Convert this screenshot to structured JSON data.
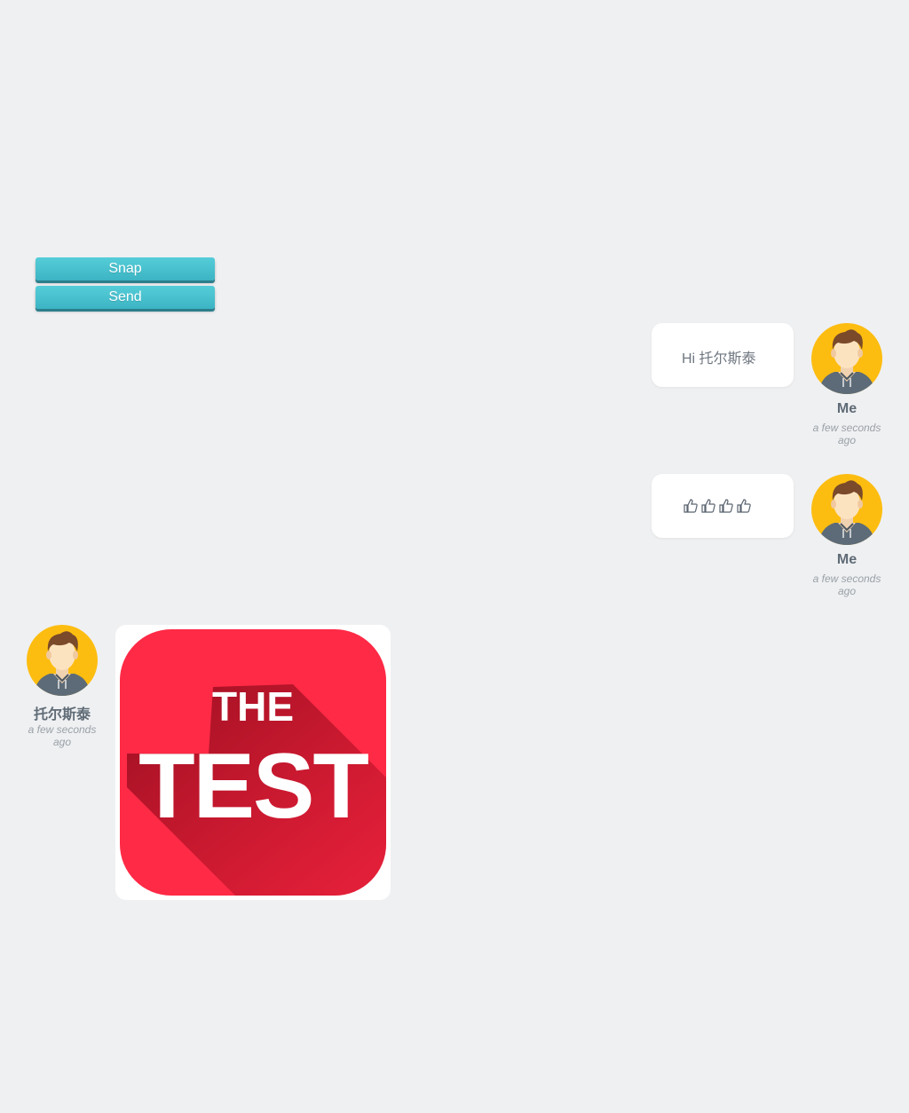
{
  "controls": {
    "snap_label": "Snap",
    "send_label": "Send"
  },
  "messages": [
    {
      "sender": "Me",
      "time": "a few seconds ago",
      "text": "Hi 托尔斯泰"
    },
    {
      "sender": "Me",
      "time": "a few seconds ago",
      "emoji": [
        "thumbs-up-icon",
        "thumbs-up-icon",
        "thumbs-up-icon",
        "thumbs-up-icon"
      ]
    },
    {
      "sender": "托尔斯泰",
      "time": "a few seconds ago",
      "image": {
        "line1": "THE",
        "line2": "TEST"
      }
    }
  ],
  "colors": {
    "background": "#eff0f2",
    "button": "#45c0ce",
    "avatar_bg": "#fdbd10",
    "image_red": "#ff2a46"
  }
}
